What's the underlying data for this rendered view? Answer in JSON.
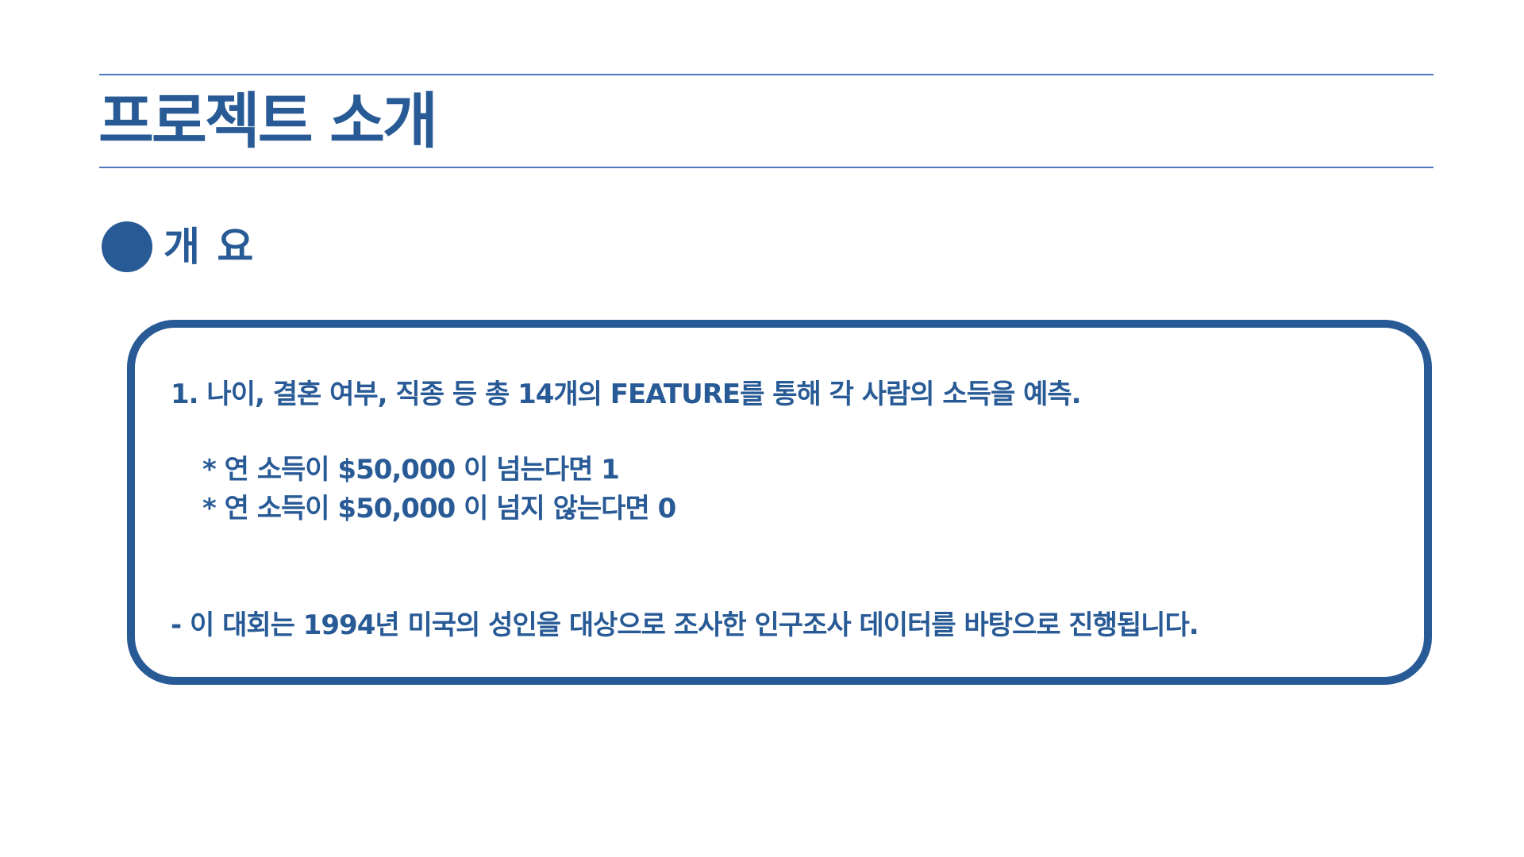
{
  "slide": {
    "title": "프로젝트 소개",
    "section_heading": "개 요",
    "content": {
      "line_1": "1. 나이, 결혼 여부, 직종 등 총 14개의 FEATURE를 통해 각 사람의 소득을 예측.",
      "bullet_1": "* 연 소득이 $50,000 이 넘는다면 1",
      "bullet_2": "* 연 소득이 $50,000 이 넘지 않는다면 0",
      "note": "- 이 대회는 1994년 미국의 성인을 대상으로 조사한 인구조사 데이터를 바탕으로 진행됩니다."
    }
  },
  "colors": {
    "accent": "#285a96",
    "rule": "#4a78b8",
    "background": "#ffffff"
  },
  "icons": {
    "section_bullet": "filled-circle-icon"
  }
}
